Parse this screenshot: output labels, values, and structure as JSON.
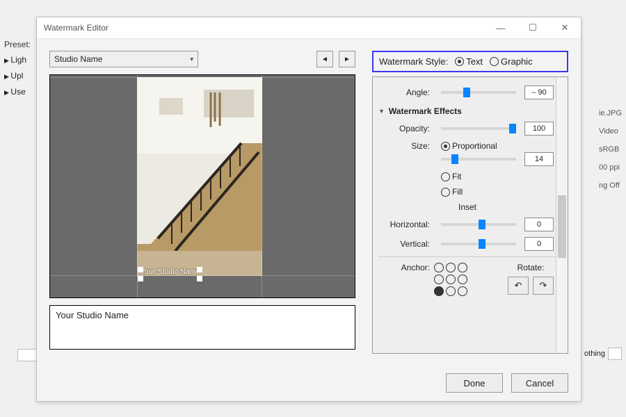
{
  "bg": {
    "preset_label": "Preset:",
    "items": [
      "Ligh",
      "Upl",
      "Use"
    ],
    "right_info": [
      "ie.JPG",
      "Video",
      "sRGB",
      "00 ppi",
      "ng Off"
    ],
    "bottom_text": "othing"
  },
  "window": {
    "title": "Watermark Editor"
  },
  "left": {
    "preset_value": "Studio Name",
    "text_value": "Your Studio Name",
    "watermark_overlay": "Your Studio Name"
  },
  "right": {
    "style_label": "Watermark Style:",
    "style_text": "Text",
    "style_graphic": "Graphic",
    "style_selected": "text",
    "angle": {
      "label": "Angle:",
      "value": "– 90",
      "knob_pct": 30
    },
    "effects_header": "Watermark Effects",
    "opacity": {
      "label": "Opacity:",
      "value": "100",
      "knob_pct": 100
    },
    "size": {
      "label": "Size:",
      "mode": "proportional",
      "opt_proportional": "Proportional",
      "opt_fit": "Fit",
      "opt_fill": "Fill",
      "value": "14",
      "knob_pct": 14
    },
    "inset": {
      "header": "Inset",
      "horizontal_label": "Horizontal:",
      "horizontal_value": "0",
      "horizontal_knob_pct": 50,
      "vertical_label": "Vertical:",
      "vertical_value": "0",
      "vertical_knob_pct": 50
    },
    "anchor_label": "Anchor:",
    "anchor_selected_index": 6,
    "rotate_label": "Rotate:"
  },
  "footer": {
    "done": "Done",
    "cancel": "Cancel"
  }
}
